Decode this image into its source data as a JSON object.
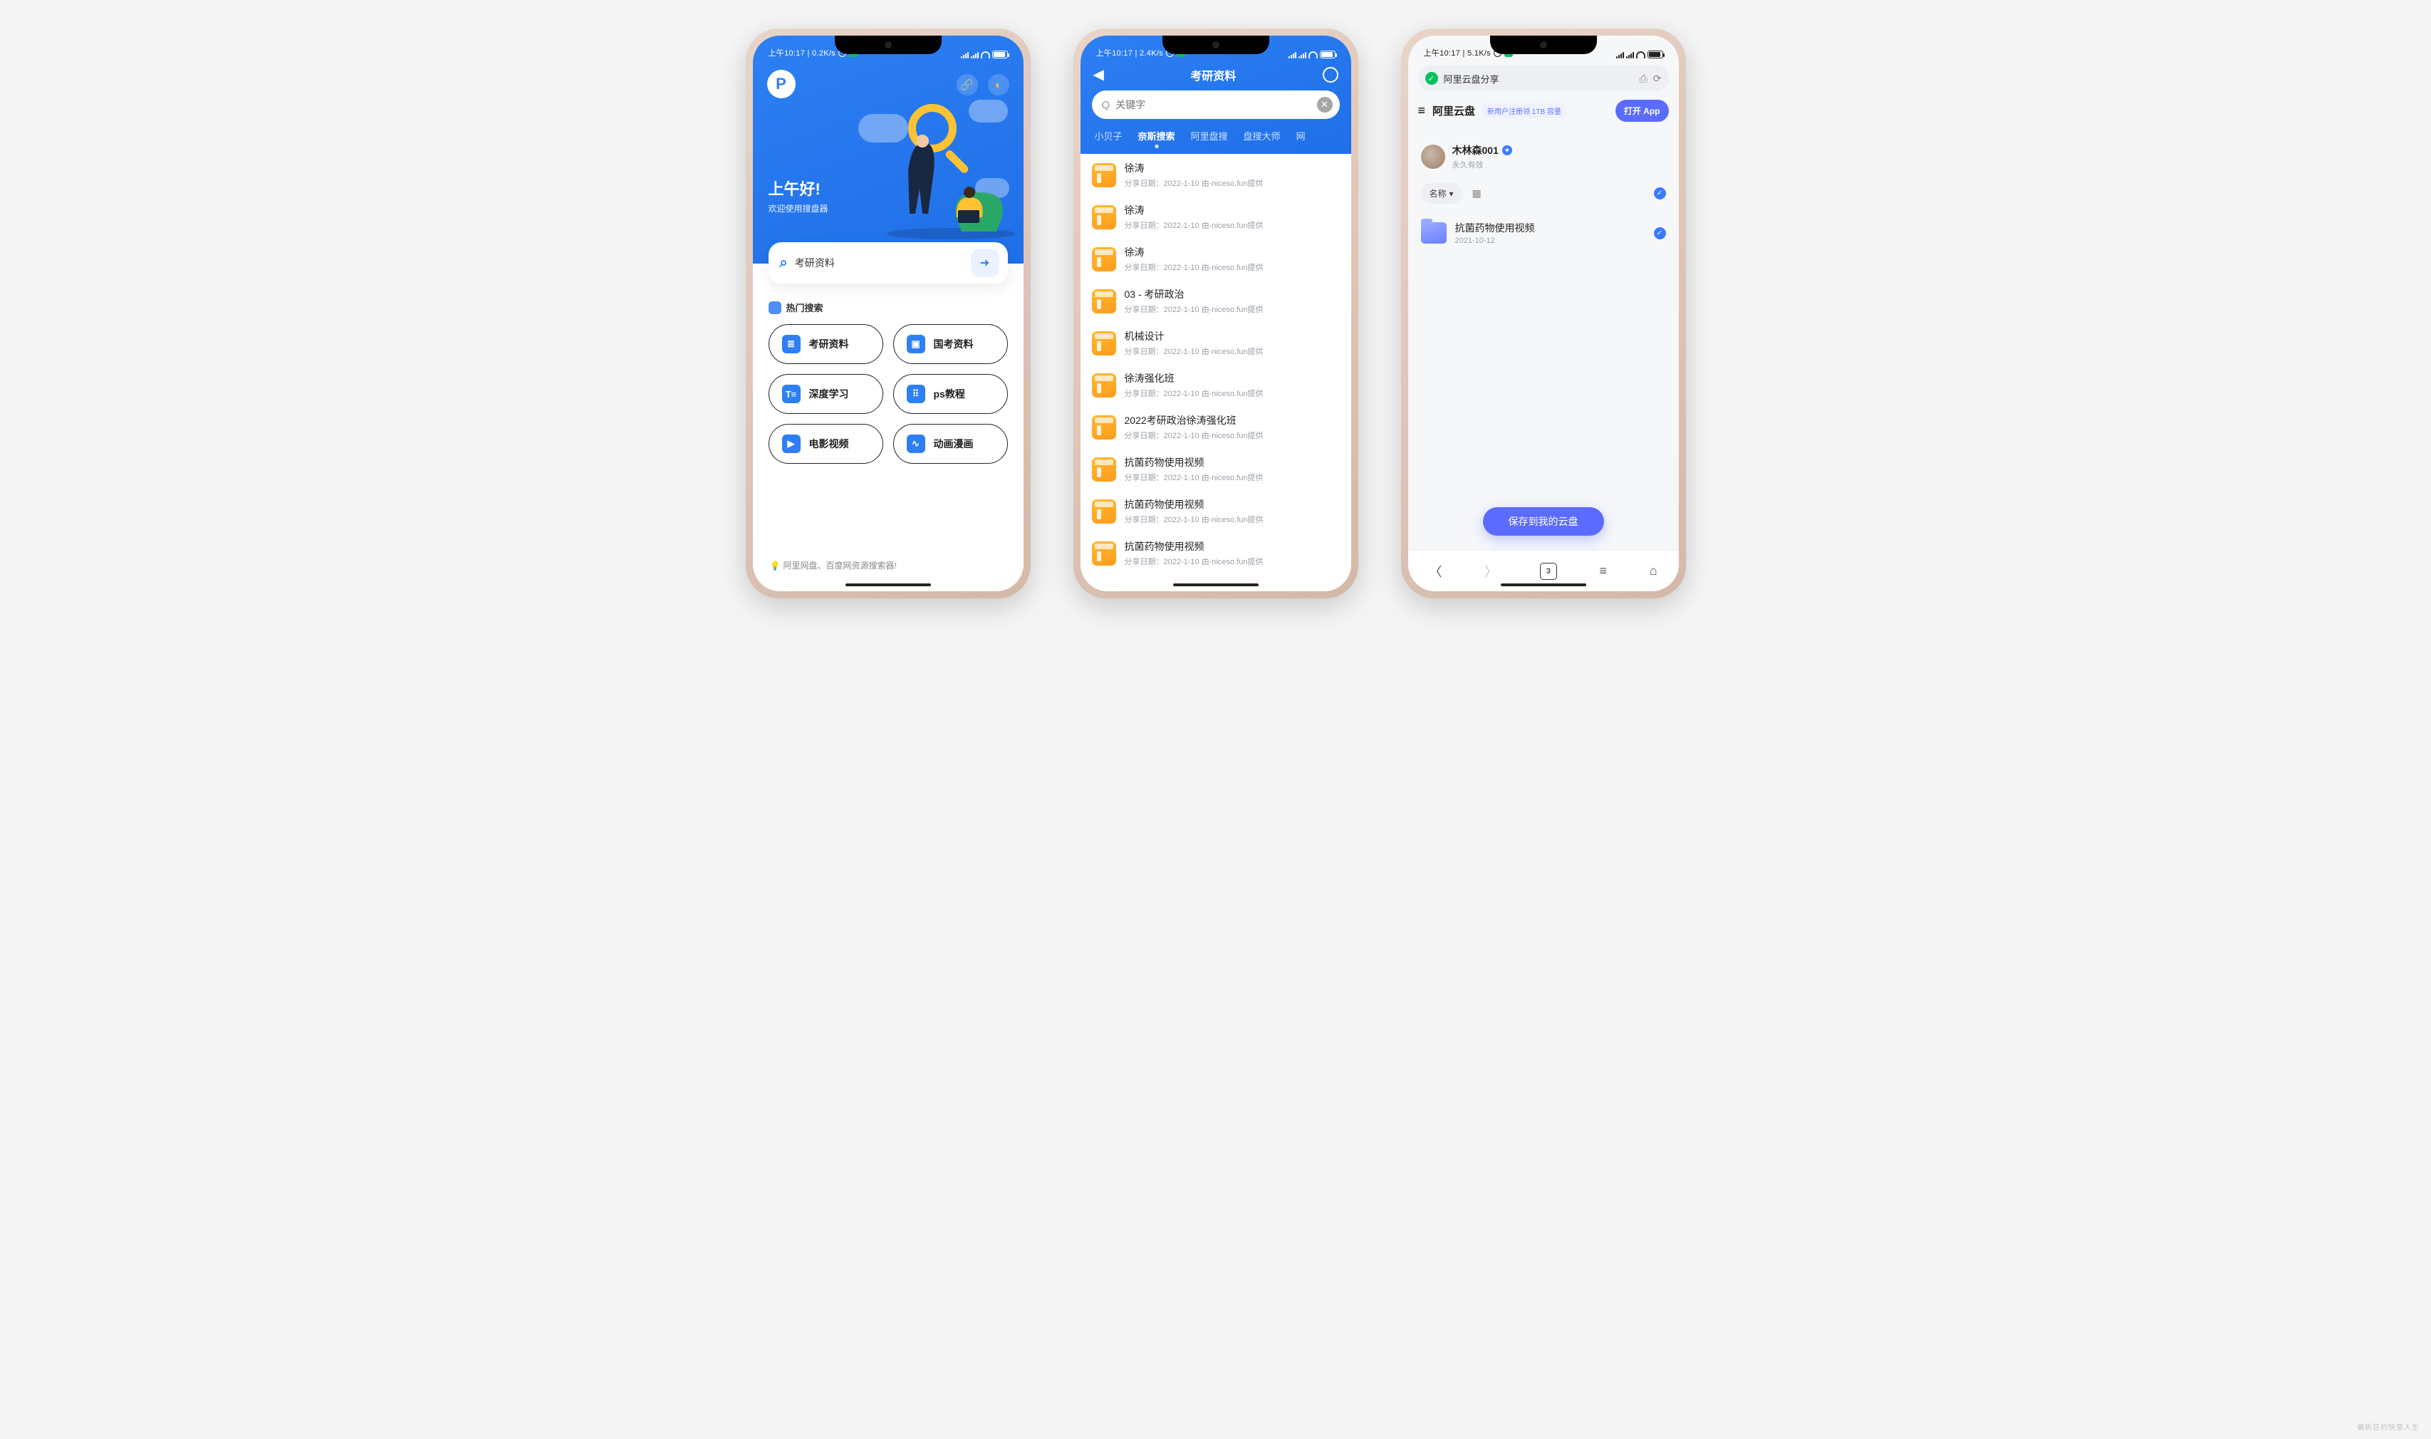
{
  "status": {
    "s1": "上午10:17 | 0.2K/s",
    "s2": "上午10:17 | 2.4K/s",
    "s3": "上午10:17 | 5.1K/s",
    "battery": "86"
  },
  "phone1": {
    "logo": "P",
    "greeting_title": "上午好!",
    "greeting_sub": "欢迎使用搜盘器",
    "search_value": "考研资料",
    "hot_title": "热门搜索",
    "chips": [
      {
        "label": "考研资料"
      },
      {
        "label": "国考资料"
      },
      {
        "label": "深度学习"
      },
      {
        "label": "ps教程"
      },
      {
        "label": "电影视频"
      },
      {
        "label": "动画漫画"
      }
    ],
    "foot": "阿里网盘、百度网资源搜索器!"
  },
  "phone2": {
    "title": "考研资料",
    "placeholder": "关键字",
    "tabs": [
      "小贝子",
      "奈斯搜索",
      "阿里盘搜",
      "盘搜大师",
      "网"
    ],
    "active_tab": 1,
    "results_meta": "分享日期：2022-1-10  由-niceso.fun提供",
    "results": [
      {
        "name": "徐涛"
      },
      {
        "name": "徐涛"
      },
      {
        "name": "徐涛"
      },
      {
        "name": "03 - 考研政治"
      },
      {
        "name": "机械设计"
      },
      {
        "name": "徐涛强化班"
      },
      {
        "name": "2022考研政治徐涛强化班"
      },
      {
        "name": "抗菌药物使用视频"
      },
      {
        "name": "抗菌药物使用视频"
      },
      {
        "name": "抗菌药物使用视频"
      }
    ]
  },
  "phone3": {
    "urlbar": "阿里云盘分享",
    "brand": "阿里云盘",
    "promo": "新用户注册领 1TB 容量",
    "open_btn": "打开 App",
    "user_name": "木林森001",
    "expire": "永久有效",
    "sort_label": "名称",
    "file_name": "抗菌药物使用视频",
    "file_date": "2021-10-12",
    "save_btn": "保存到我的云盘",
    "tab_count": "3"
  },
  "watermark": "偏执狂的快意人生"
}
